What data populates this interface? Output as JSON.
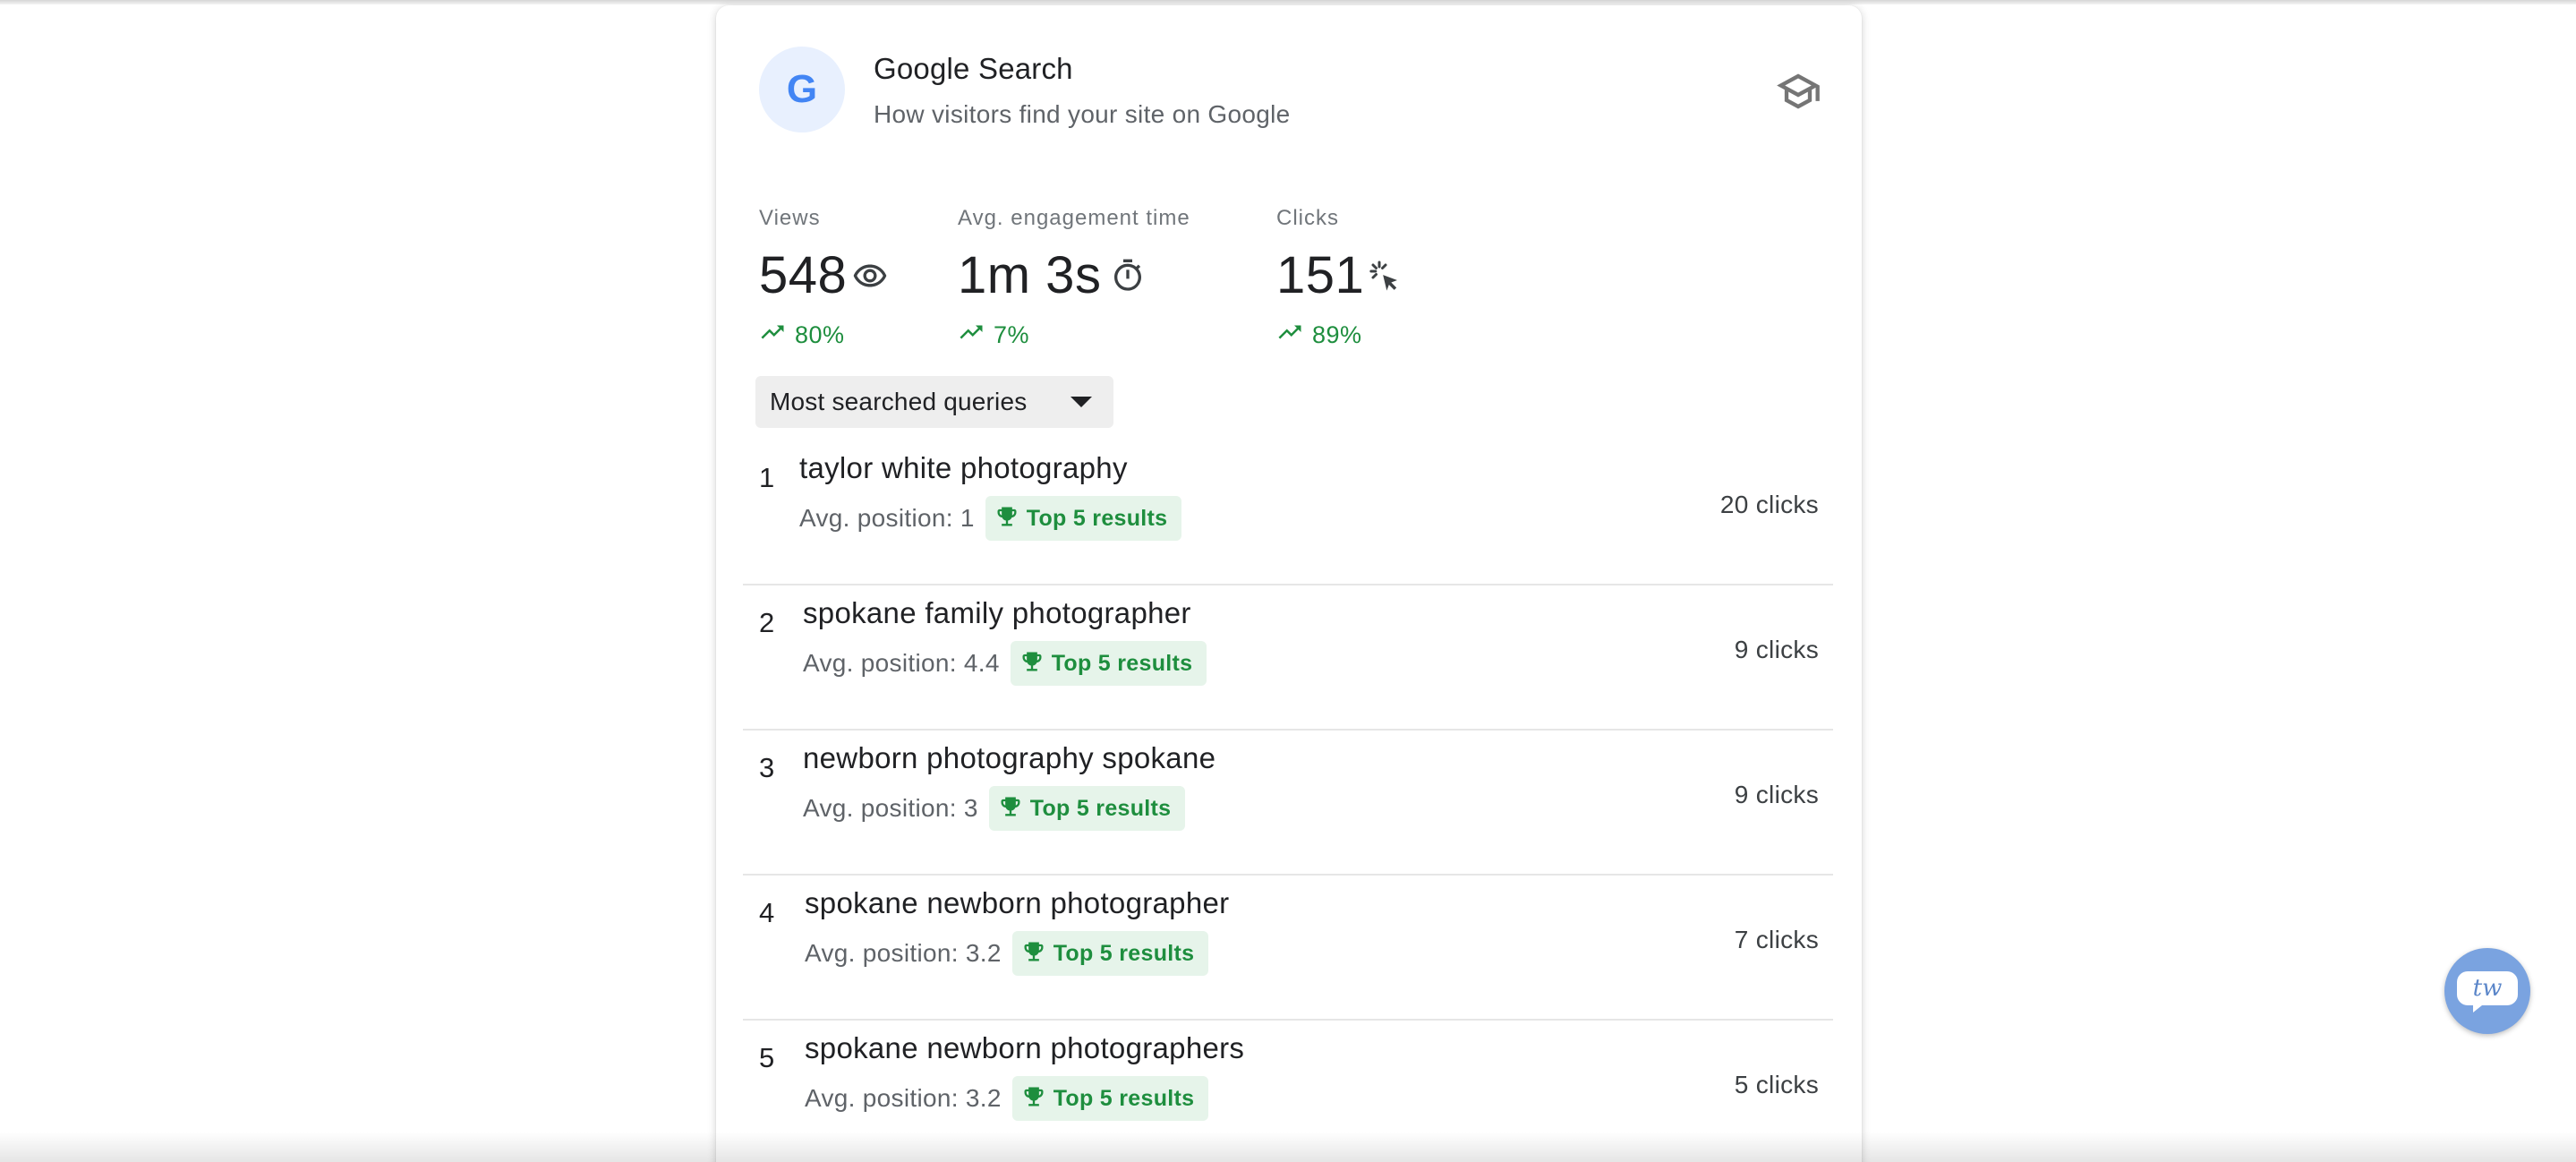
{
  "card": {
    "logo_letter": "G",
    "title": "Google Search",
    "subtitle": "How visitors find your site on Google",
    "learn_icon": "graduation-cap-icon"
  },
  "metrics": [
    {
      "label": "Views",
      "value": "548",
      "icon": "eye-icon",
      "trend": "80%"
    },
    {
      "label": "Avg. engagement time",
      "value": "1m 3s",
      "icon": "timer-icon",
      "trend": "7%"
    },
    {
      "label": "Clicks",
      "value": "151",
      "icon": "cursor-click-icon",
      "trend": "89%"
    }
  ],
  "dropdown": {
    "selected": "Most searched queries"
  },
  "queries": [
    {
      "rank": "1",
      "query": "taylor white photography",
      "position": "Avg. position: 1",
      "badge": "Top 5 results",
      "clicks": "20 clicks"
    },
    {
      "rank": "2",
      "query": "spokane family photographer",
      "position": "Avg. position: 4.4",
      "badge": "Top 5 results",
      "clicks": "9 clicks"
    },
    {
      "rank": "3",
      "query": "newborn photography spokane",
      "position": "Avg. position: 3",
      "badge": "Top 5 results",
      "clicks": "9 clicks"
    },
    {
      "rank": "4",
      "query": "spokane newborn photographer",
      "position": "Avg. position: 3.2",
      "badge": "Top 5 results",
      "clicks": "7 clicks"
    },
    {
      "rank": "5",
      "query": "spokane newborn photographers",
      "position": "Avg. position: 3.2",
      "badge": "Top 5 results",
      "clicks": "5 clicks"
    }
  ],
  "help_bubble": {
    "text": "tw",
    "icon": "chat-help-icon"
  },
  "colors": {
    "accent_blue": "#4285f4",
    "trend_green": "#1e8e3e",
    "badge_bg": "#e6f4ea",
    "logo_bg": "#e8f0fe",
    "bubble": "#7aa3e0"
  }
}
